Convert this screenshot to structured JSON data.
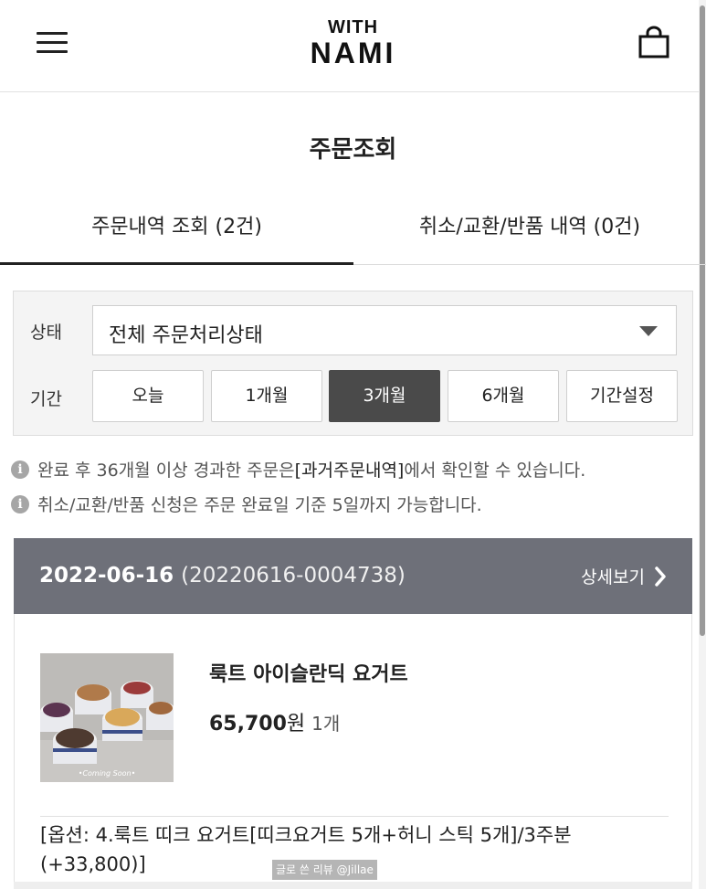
{
  "header": {
    "logo_top": "WITH",
    "logo_bottom": "NAMI"
  },
  "page": {
    "title": "주문조회"
  },
  "tabs": [
    {
      "label": "주문내역 조회 (2건)",
      "active": true
    },
    {
      "label": "취소/교환/반품 내역 (0건)",
      "active": false
    }
  ],
  "filter": {
    "status_label": "상태",
    "status_value": "전체 주문처리상태",
    "period_label": "기간",
    "periods": [
      "오늘",
      "1개월",
      "3개월",
      "6개월",
      "기간설정"
    ],
    "selected_period": "3개월"
  },
  "notices": {
    "n1_pre": "완료 후 36개월 이상 경과한 주문은 ",
    "n1_link": "[과거주문내역]",
    "n1_post": "에서 확인할 수 있습니다.",
    "n2": "취소/교환/반품 신청은 주문 완료일 기준 5일까지 가능합니다."
  },
  "order": {
    "date": "2022-06-16",
    "number": "(20220616-0004738)",
    "detail_label": "상세보기",
    "product_name": "룩트 아이슬란딕 요거트",
    "price": "65,700",
    "currency": "원",
    "quantity": "1개",
    "thumbnail_caption": "•Coming Soon•",
    "option": "[옵션: 4.룩트 띠크 요거트[띠크요거트 5개+허니 스틱 5개]/3주분 (+33,800)]"
  },
  "watermark": "글로 쓴 리뷰 @Jillae",
  "colors": {
    "order_header_bg": "#6e7079",
    "selected_period_bg": "#4a4a4a"
  }
}
